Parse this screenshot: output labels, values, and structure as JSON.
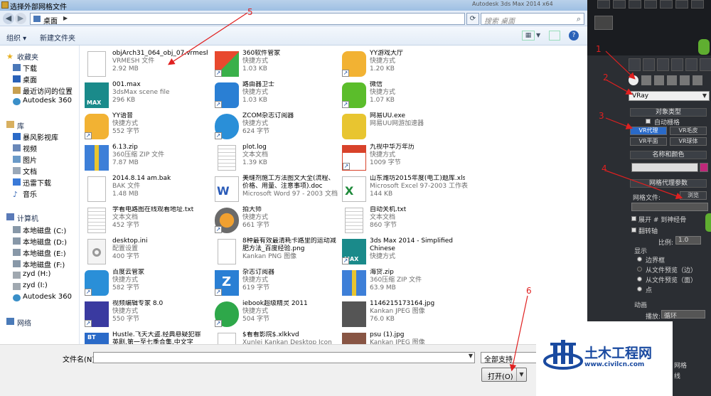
{
  "window": {
    "title": "选择外部网格文件",
    "background_app": "Autodesk 3ds Max 2014 x64"
  },
  "address": {
    "path": "桌面",
    "search_placeholder": "搜索 桌面"
  },
  "toolbar": {
    "organize": "组织 ▾",
    "new_folder": "新建文件夹"
  },
  "sidebar": {
    "favorites": {
      "label": "收藏夹",
      "items": [
        "下载",
        "桌面",
        "最近访问的位置",
        "Autodesk 360"
      ]
    },
    "library": {
      "label": "库",
      "items": [
        "暴风影视库",
        "视频",
        "图片",
        "文档",
        "迅雷下载",
        "音乐"
      ]
    },
    "computer": {
      "label": "计算机",
      "items": [
        "本地磁盘 (C:)",
        "本地磁盘 (D:)",
        "本地磁盘 (E:)",
        "本地磁盘 (F:)",
        "zyd (H:)",
        "zyd (I:)",
        "Autodesk 360"
      ]
    },
    "network": {
      "label": "网络"
    }
  },
  "files": [
    {
      "name": "objArch31_064_obj_07.vrmesh",
      "type": "VRMESH 文件",
      "size": "2.92 MB",
      "icon": "blank-file-icon",
      "color": "#ffffff"
    },
    {
      "name": "360软件管家",
      "type": "快捷方式",
      "size": "1.03 KB",
      "icon": "360-manager-icon",
      "color": "#e8492e"
    },
    {
      "name": "YY游戏大厅",
      "type": "快捷方式",
      "size": "1.20 KB",
      "icon": "yy-game-icon",
      "color": "#f2b233"
    },
    {
      "name": "001.max",
      "type": "3dsMax scene file",
      "size": "296 KB",
      "icon": "3dsmax-file-icon",
      "color": "#1a8a8a"
    },
    {
      "name": "路由器卫士",
      "type": "快捷方式",
      "size": "1.03 KB",
      "icon": "router-guard-icon",
      "color": "#2a7fd4"
    },
    {
      "name": "微信",
      "type": "快捷方式",
      "size": "1.07 KB",
      "icon": "wechat-icon",
      "color": "#5bbd2b"
    },
    {
      "name": "YY语音",
      "type": "快捷方式",
      "size": "552 字节",
      "icon": "yy-voice-icon",
      "color": "#f2b233"
    },
    {
      "name": "ZCOM杂志订阅器",
      "type": "快捷方式",
      "size": "624 字节",
      "icon": "zcom-icon",
      "color": "#2a8fd8"
    },
    {
      "name": "网易UU.exe",
      "type": "网易UU网游加速器",
      "size": "",
      "icon": "netease-uu-icon",
      "color": "#e8c530"
    },
    {
      "name": "6.13.zip",
      "type": "360压缩 ZIP 文件",
      "size": "7.87 MB",
      "icon": "zip-icon",
      "color": "#3d7fd8"
    },
    {
      "name": "plot.log",
      "type": "文本文档",
      "size": "1.39 KB",
      "icon": "text-file-icon",
      "color": "#ffffff"
    },
    {
      "name": "九视中华万年历",
      "type": "快捷方式",
      "size": "1009 字节",
      "icon": "calendar-icon",
      "color": "#d8422a"
    },
    {
      "name": "2014.8.14 am.bak",
      "type": "BAK 文件",
      "size": "1.48 MB",
      "icon": "blank-file-icon",
      "color": "#ffffff"
    },
    {
      "name": "美缝剂施工方法图文大全(流程、价格、用量、注意事项).doc",
      "type": "Microsoft Word 97 - 2003 文档",
      "size": "",
      "icon": "word-doc-icon",
      "color": "#2a5bb8"
    },
    {
      "name": "山东潍坊2015年度(电工)题库.xls",
      "type": "Microsoft Excel 97-2003 工作表",
      "size": "144 KB",
      "icon": "excel-icon",
      "color": "#1e8a3a"
    },
    {
      "name": "学看电路图在线观看地址.txt",
      "type": "文本文档",
      "size": "452 字节",
      "icon": "text-file-icon",
      "color": "#ffffff"
    },
    {
      "name": "拍大师",
      "type": "快捷方式",
      "size": "661 字节",
      "icon": "paidashi-icon",
      "color": "#d85020"
    },
    {
      "name": "自动关机.txt",
      "type": "文本文档",
      "size": "860 字节",
      "icon": "text-file-icon",
      "color": "#ffffff"
    },
    {
      "name": "desktop.ini",
      "type": "配置设置",
      "size": "400 字节",
      "icon": "ini-file-icon",
      "color": "#dddddd"
    },
    {
      "name": "8种最有效最清耗卡路里的运动减肥方法_百度经验.png",
      "type": "Kankan PNG 图像",
      "size": "",
      "icon": "png-file-icon",
      "color": "#ffffff"
    },
    {
      "name": "3ds Max 2014 - Simplified Chinese",
      "type": "快捷方式",
      "size": "",
      "icon": "3dsmax-icon",
      "color": "#1a8a8a"
    },
    {
      "name": "百度云管家",
      "type": "快捷方式",
      "size": "582 字节",
      "icon": "baidu-cloud-icon",
      "color": "#2a8fd8"
    },
    {
      "name": "杂志订阅器",
      "type": "快捷方式",
      "size": "619 字节",
      "icon": "magazine-icon",
      "color": "#2a7fd4"
    },
    {
      "name": "海贷.zip",
      "type": "360压缩 ZIP 文件",
      "size": "63.9 MB",
      "icon": "zip-icon",
      "color": "#3d7fd8"
    },
    {
      "name": "视频编辑专家 8.0",
      "type": "快捷方式",
      "size": "550 字节",
      "icon": "video-editor-icon",
      "color": "#3a3aa0"
    },
    {
      "name": "iebook超级精灵 2011",
      "type": "快捷方式",
      "size": "504 字节",
      "icon": "iebook-icon",
      "color": "#2ea84a"
    },
    {
      "name": "1146215173164.jpg",
      "type": "Kankan JPEG 图像",
      "size": "76.0 KB",
      "icon": "jpg-thumb-icon",
      "color": "#555555"
    },
    {
      "name": "Hustle.飞天大盗.经典悬疑犯罪英剧.第一至七季合集.中文字幕.torr...",
      "type": "",
      "size": "",
      "icon": "bt-torrent-icon",
      "color": "#2a6ac8"
    },
    {
      "name": "$看看影院$.xlkkvd",
      "type": "Xunlei Kankan Desktop Icon",
      "size": "",
      "icon": "blank-file-icon",
      "color": "#ffffff"
    },
    {
      "name": "psu (1).jpg",
      "type": "Kankan JPEG 图像",
      "size": "",
      "icon": "jpg-thumb-icon",
      "color": "#885544"
    }
  ],
  "footer": {
    "filename_label": "文件名(N):",
    "filename_value": "",
    "filetype": "全部支持",
    "open_button": "打开(O)"
  },
  "max_panel": {
    "renderer": "VRay",
    "rollout_object_type": "对象类型",
    "auto_grid": "自动栅格",
    "btn_vr_proxy": "VR代理",
    "btn_vr_fur": "VR毛皮",
    "btn_vr_plane": "VR平面",
    "btn_vr_sphere": "VR球体",
    "rollout_name_color": "名称和颜色",
    "rollout_mesh_proxy": "网格代理参数",
    "mesh_file_label": "网格文件:",
    "browse_button": "浏览",
    "expand_label": "展开 # 到神经骨",
    "flip_axis": "翻转轴",
    "scale_label": "比例:",
    "scale_value": "1.0",
    "display_label": "显示",
    "radio_bbox": "边界框",
    "radio_preview_edges": "从文件预览（边）",
    "radio_preview_faces": "从文件预览（面）",
    "radio_point": "点",
    "anim_label": "动画",
    "play_label": "播放:",
    "play_value": "循环",
    "grid_label": "网格",
    "line_label": "线"
  },
  "annotations": [
    "5",
    "1",
    "2",
    "3",
    "4",
    "6"
  ],
  "watermark": {
    "brand": "土木工程网",
    "url": "www.civilcn.com"
  }
}
